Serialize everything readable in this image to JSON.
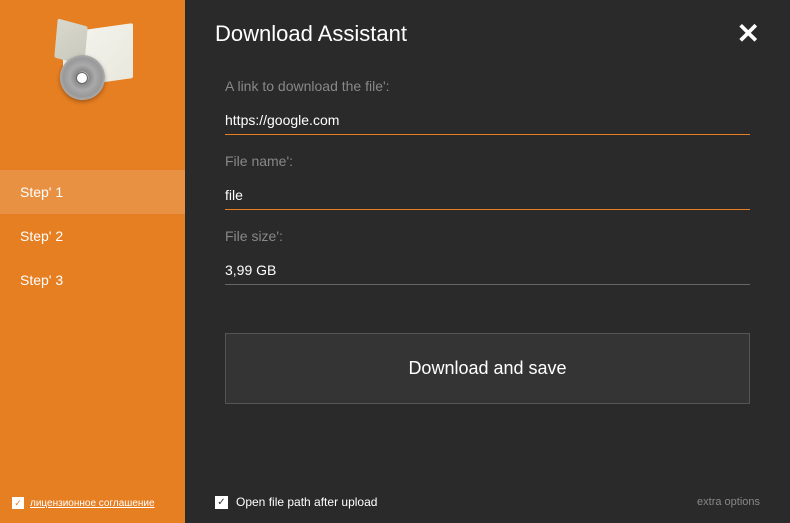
{
  "header": {
    "title": "Download Assistant"
  },
  "sidebar": {
    "steps": [
      {
        "label": "Step' 1",
        "active": true
      },
      {
        "label": "Step' 2",
        "active": false
      },
      {
        "label": "Step' 3",
        "active": false
      }
    ],
    "license": {
      "checked": true,
      "text": "лицензионное соглашение"
    }
  },
  "form": {
    "link": {
      "label": "A link to download the file':",
      "value": "https://google.com"
    },
    "filename": {
      "label": "File name':",
      "value": "file"
    },
    "filesize": {
      "label": "File size':",
      "value": "3,99 GB"
    },
    "download_button": "Download and save"
  },
  "footer": {
    "open_path": {
      "checked": true,
      "text": "Open file path after upload"
    },
    "extra_options": "extra options"
  }
}
